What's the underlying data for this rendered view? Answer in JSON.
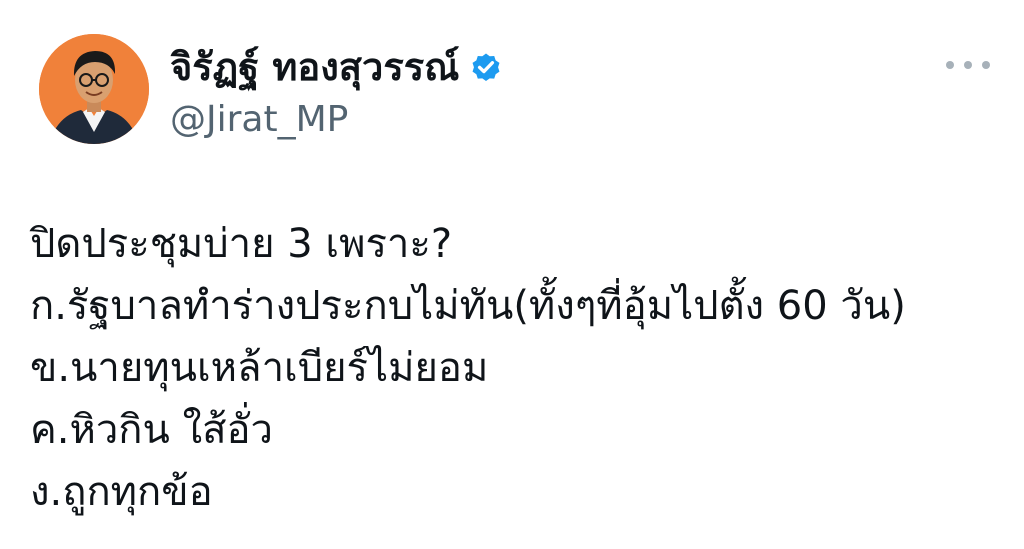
{
  "author": {
    "display_name": "จิรัฏฐ์ ทองสุวรรณ์",
    "handle": "@Jirat_MP",
    "verified": true,
    "avatar": "profile-photo",
    "avatar_bg_color": "#f0813a"
  },
  "verified_badge_color": "#1d9bf0",
  "more_menu": {
    "icon": "more-horizontal-icon"
  },
  "tweet": {
    "lines": [
      "ปิดประชุมบ่าย 3 เพราะ?",
      "ก.รัฐบาลทำร่างประกบไม่ทัน(ทั้งๆที่อุ้มไปตั้ง 60 วัน)",
      "ข.นายทุนเหล้าเบียร์ไม่ยอม",
      "ค.หิวกิน ใส้อั่ว",
      "ง.ถูกทุกข้อ"
    ]
  }
}
